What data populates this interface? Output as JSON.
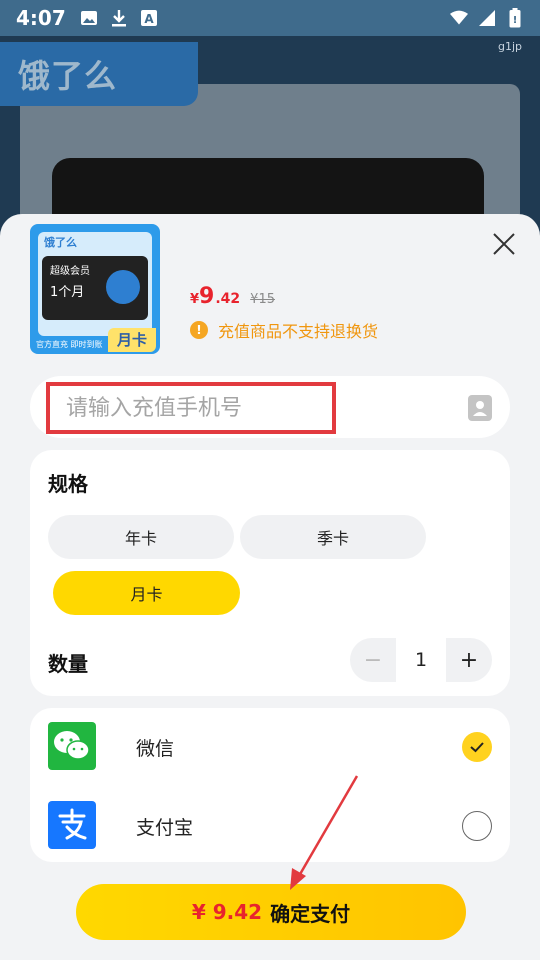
{
  "status_bar": {
    "time": "4:07",
    "left_icons": [
      "image-icon",
      "download-icon",
      "a-icon"
    ],
    "right_icons": [
      "wifi-icon",
      "signal-icon",
      "battery-icon"
    ]
  },
  "background": {
    "logo_text": "饿了么",
    "watermark": "g1jp"
  },
  "product": {
    "image_logo": "饿了么",
    "image_card_line1": "超级会员",
    "image_card_line2": "1个月",
    "image_badge": "月卡",
    "image_footer": "官方直充 即时到账",
    "price_symbol": "¥",
    "price_int": "9",
    "price_dec": ".42",
    "price_old": "¥15",
    "notice": "充值商品不支持退换货"
  },
  "phone": {
    "placeholder": "请输入充值手机号"
  },
  "spec": {
    "title": "规格",
    "options": [
      {
        "label": "年卡",
        "selected": false
      },
      {
        "label": "季卡",
        "selected": false
      },
      {
        "label": "月卡",
        "selected": true
      }
    ]
  },
  "quantity": {
    "title": "数量",
    "minus": "−",
    "value": "1",
    "plus": "+"
  },
  "payment": {
    "methods": [
      {
        "label": "微信",
        "checked": true,
        "color": "#21b640"
      },
      {
        "label": "支付宝",
        "checked": false,
        "color": "#1677ff"
      }
    ]
  },
  "confirm": {
    "price": "¥ 9.42",
    "label": "确定支付"
  },
  "colors": {
    "accent_yellow": "#ffd800",
    "price_red": "#e8232d",
    "annotation_red": "#e23a3f"
  }
}
